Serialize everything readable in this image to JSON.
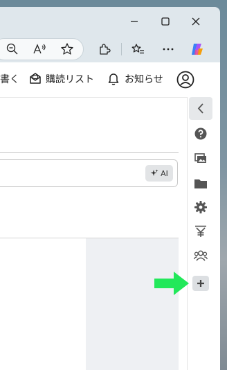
{
  "header": {
    "truncated_label": "書く",
    "reading_list_label": "購読リスト",
    "notifications_label": "お知らせ"
  },
  "search": {
    "ai_label": "AI"
  },
  "icons": {
    "window": [
      "minimize-icon",
      "maximize-icon",
      "close-icon"
    ],
    "toolbar": [
      "zoom-out-icon",
      "read-aloud-icon",
      "favorite-star-icon",
      "extensions-icon",
      "favorites-icon",
      "more-icon",
      "copilot-icon"
    ],
    "sidebar": [
      "collapse-chevron-icon",
      "help-icon",
      "gallery-icon",
      "folder-icon",
      "settings-icon",
      "yen-icon",
      "people-icon",
      "add-icon"
    ]
  },
  "colors": {
    "accent_arrow": "#22e85a",
    "copilot_blue": "#3b82f6",
    "copilot_orange": "#f59e0b"
  }
}
